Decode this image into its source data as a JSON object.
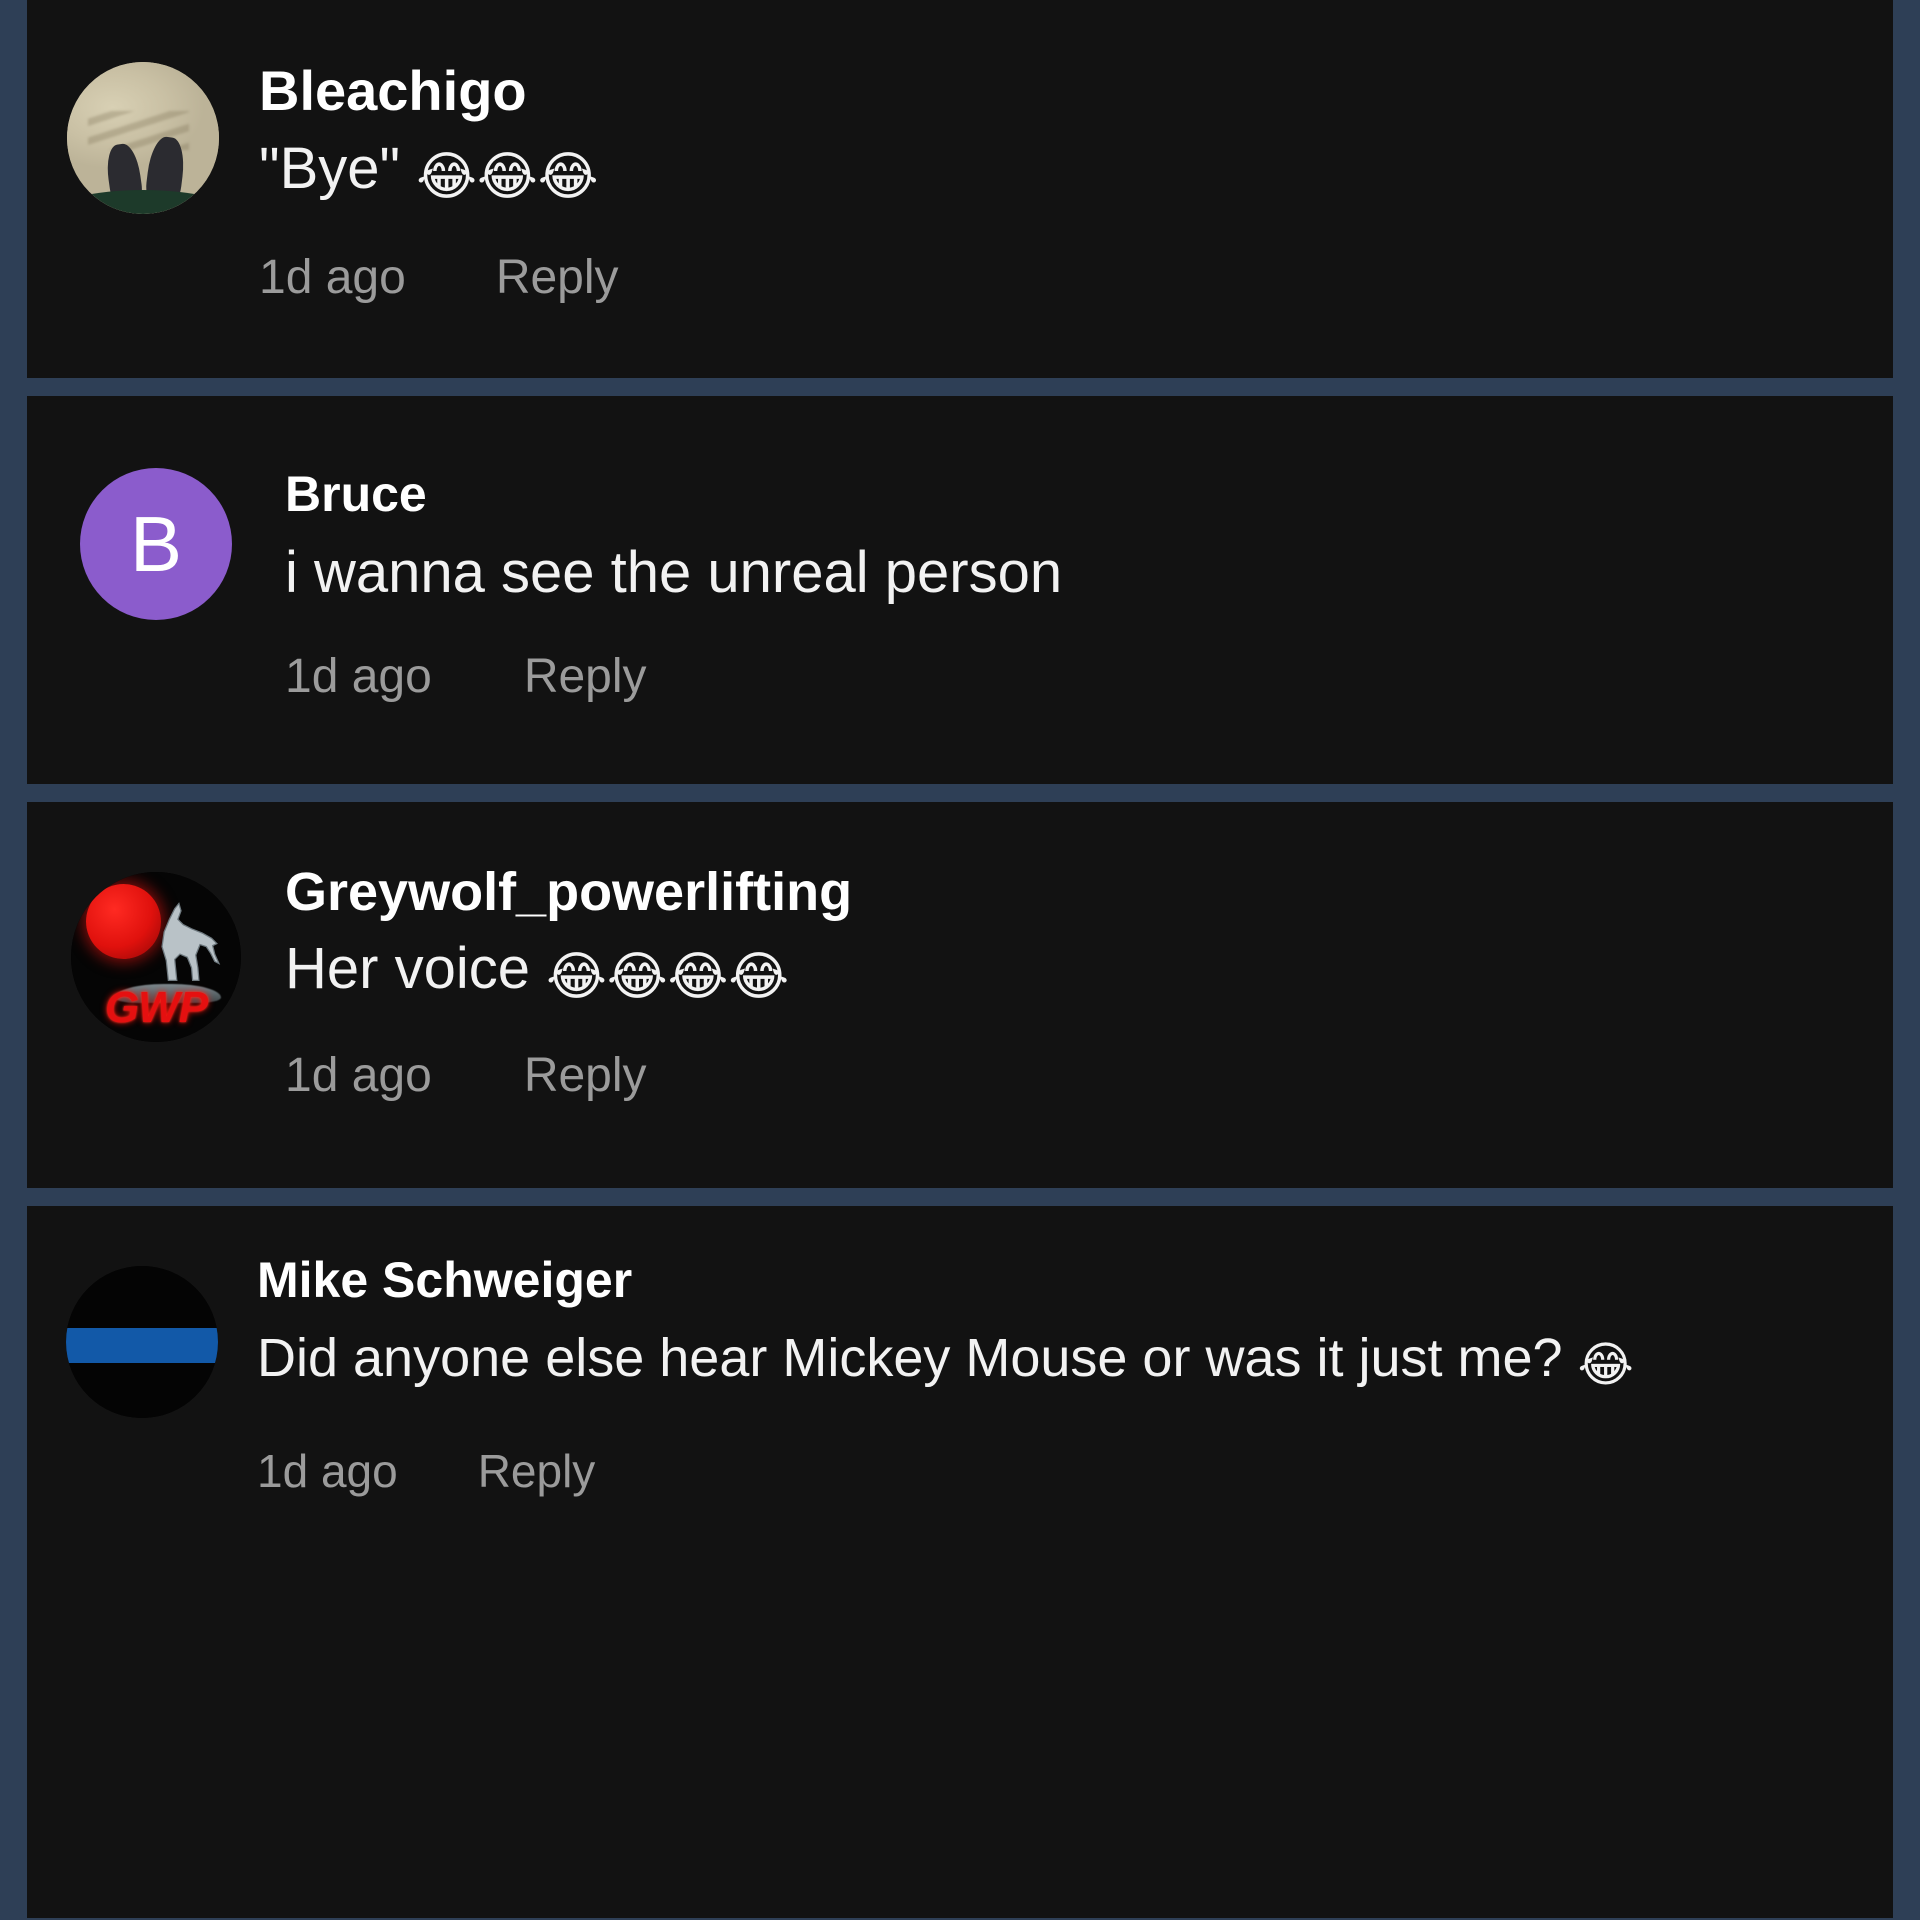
{
  "theme": {
    "page_background": "#2e3f56",
    "card_background": "#121212",
    "author_color": "#ffffff",
    "message_color": "#f2f2f2",
    "meta_color": "#9b9b9b"
  },
  "comments": [
    {
      "author": "Bleachigo",
      "message_text": "\"Bye\" ",
      "emojis": "😂😂😂",
      "timestamp": "1d ago",
      "reply_label": "Reply",
      "avatar": {
        "type": "photo",
        "name": "avatar-photo-ground-shoes"
      }
    },
    {
      "author": "Bruce",
      "message_text": "i wanna see the unreal person",
      "emojis": "",
      "timestamp": "1d ago",
      "reply_label": "Reply",
      "avatar": {
        "type": "initial",
        "initial": "B",
        "background_color": "#8b5ccc",
        "name": "avatar-initial-b"
      }
    },
    {
      "author": "Greywolf_powerlifting",
      "message_text": "Her voice ",
      "emojis": "😂😂😂😂",
      "timestamp": "1d ago",
      "reply_label": "Reply",
      "avatar": {
        "type": "gwp-logo",
        "logo_text": "GWP",
        "logo_color": "#e51010",
        "name": "avatar-gwp-wolf-logo"
      }
    },
    {
      "author": "Mike Schweiger",
      "message_text": "Did anyone else hear Mickey Mouse or was it just me? ",
      "emojis": "😂",
      "timestamp": "1d ago",
      "reply_label": "Reply",
      "avatar": {
        "type": "flag",
        "stripe_color": "#1259a8",
        "name": "avatar-thin-blue-line-flag"
      }
    }
  ]
}
